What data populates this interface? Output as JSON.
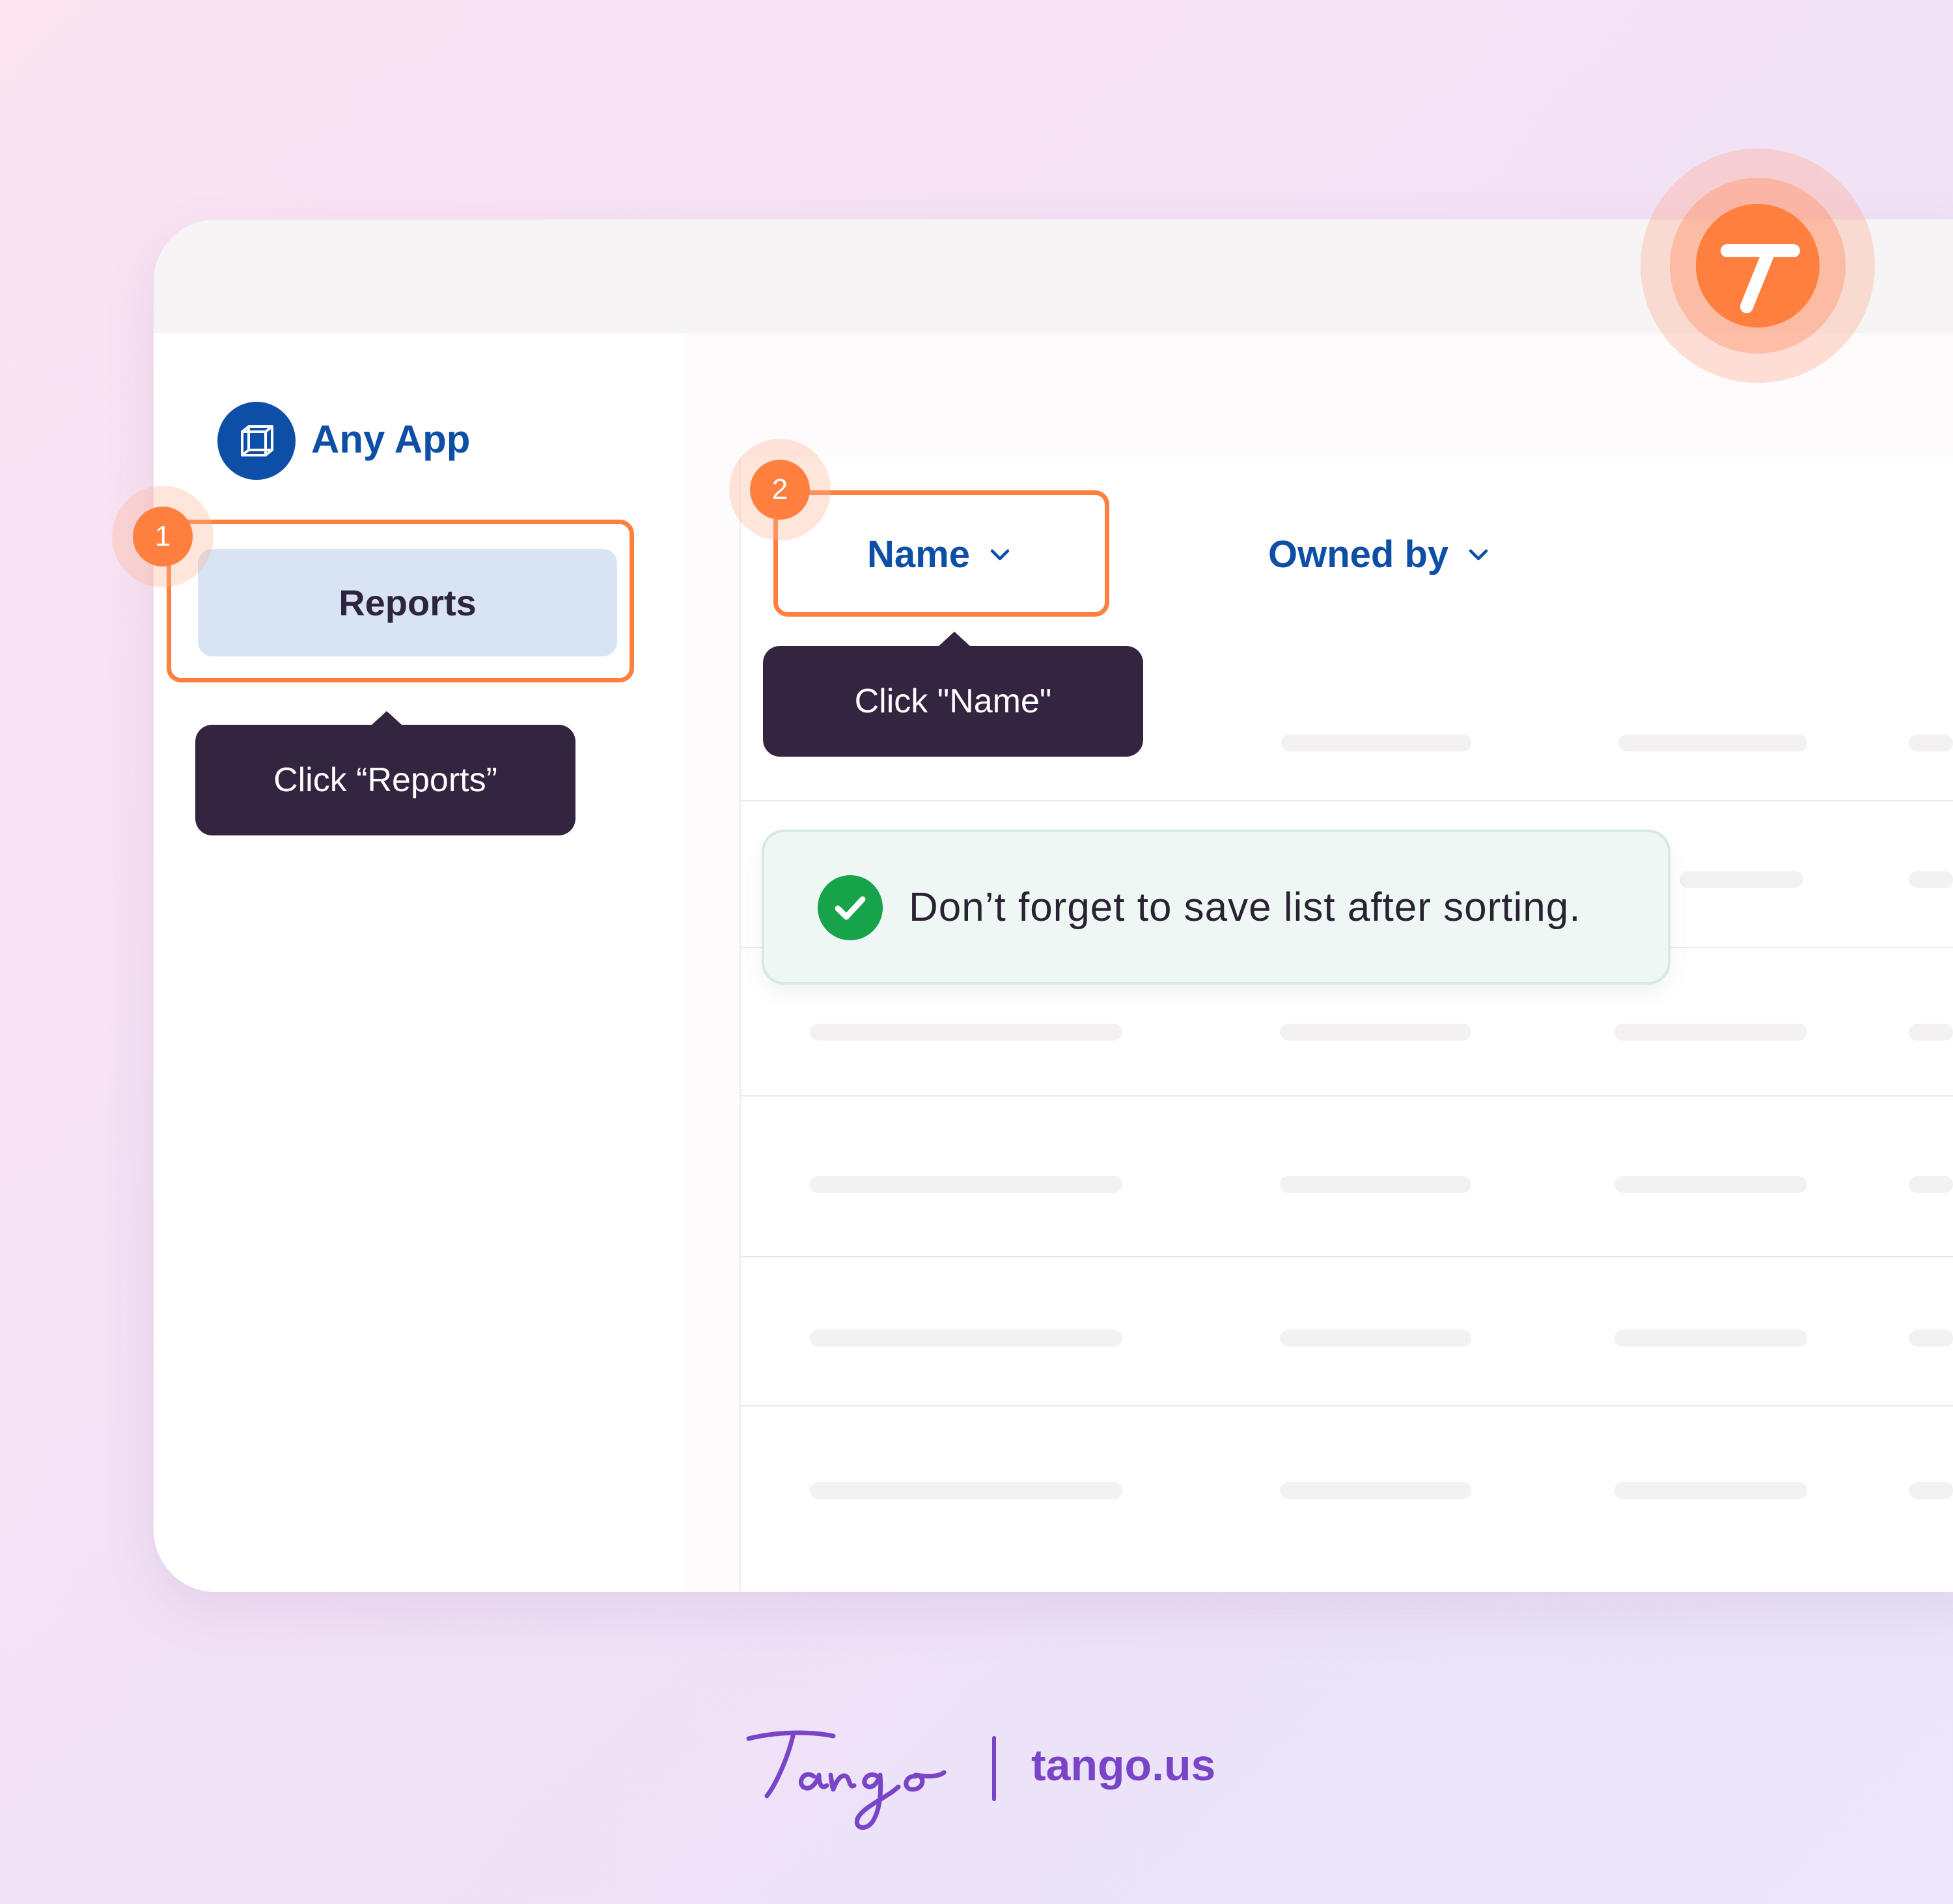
{
  "app": {
    "name": "Any App",
    "logo_icon": "box-icon"
  },
  "sidebar": {
    "reports_label": "Reports"
  },
  "steps": [
    {
      "number": "1",
      "tooltip": "Click “Reports”"
    },
    {
      "number": "2",
      "tooltip": "Click \"Name\""
    }
  ],
  "table": {
    "columns": [
      {
        "label": "Name",
        "icon": "chevron-down-icon"
      },
      {
        "label": "Owned by",
        "icon": "chevron-down-icon"
      }
    ]
  },
  "toast": {
    "message": "Don’t forget to save list after sorting.",
    "icon": "check-circle-icon",
    "color": "#16a34a"
  },
  "brand": {
    "script_logo": "Tango",
    "url": "tango.us",
    "accent": "#ff7f3f",
    "purple": "#7a44c8",
    "blue": "#0d4fa6"
  }
}
